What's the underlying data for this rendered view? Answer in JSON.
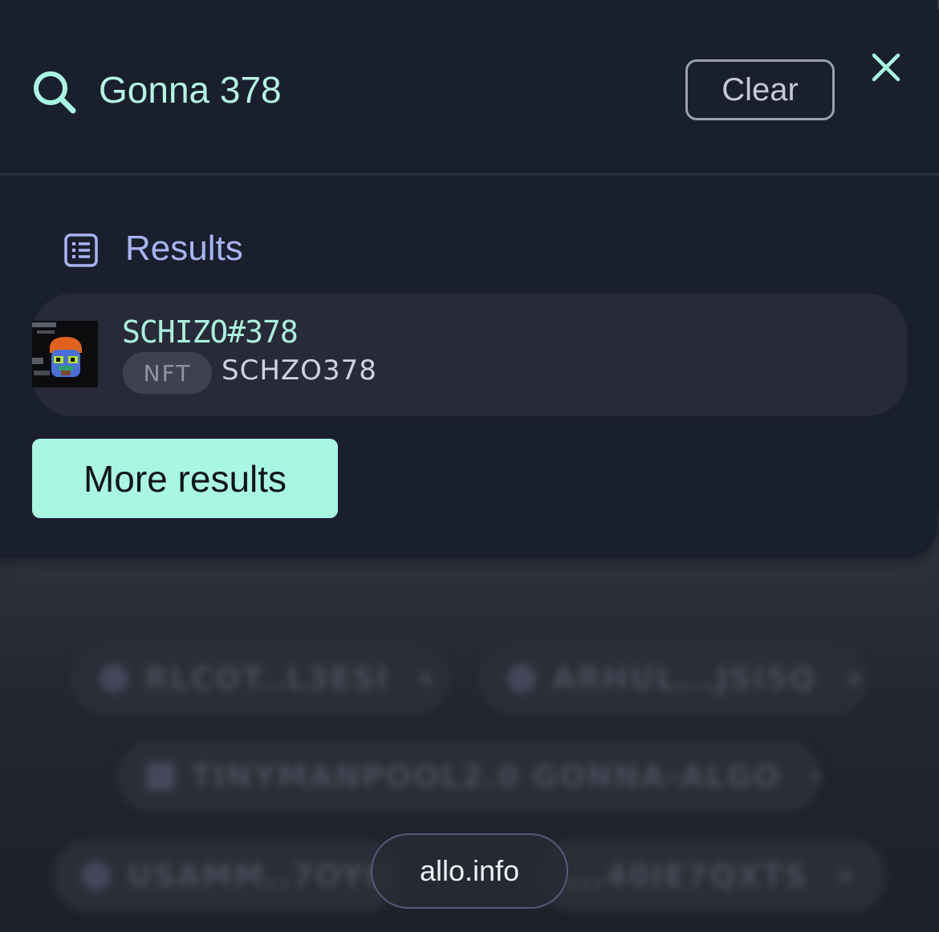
{
  "search": {
    "query": "Gonna 378",
    "clear_label": "Clear"
  },
  "results": {
    "title": "Results",
    "items": [
      {
        "name": "SCHIZO#378",
        "type": "NFT",
        "code": "SCHZO378"
      }
    ],
    "more_label": "More results"
  },
  "background_chips": [
    {
      "label": "RLCOT..L3ESI"
    },
    {
      "label": "ARHUL...JSI5Q"
    },
    {
      "label": "TINYMANPOOL2.0 GONNA-ALGO"
    },
    {
      "label": "USAMM..7OYQ"
    },
    {
      "label": "...40IE7QXTS"
    }
  ],
  "footer": {
    "site": "allo.info"
  },
  "colors": {
    "accent": "#a9f6e2",
    "panel": "#1a1f2e",
    "results_title": "#a8b4f2"
  }
}
